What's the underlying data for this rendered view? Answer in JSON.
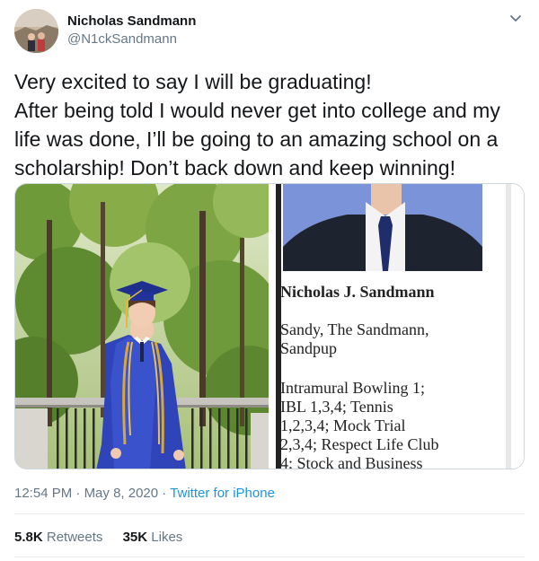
{
  "user": {
    "display_name": "Nicholas Sandmann",
    "handle": "@N1ckSandmann"
  },
  "tweet": {
    "text": "Very excited to say I will be graduating!\nAfter being told I would never get into college and my life was done, I’ll be going to an amazing school on a scholarship! Don’t back down and keep winning!"
  },
  "media": {
    "yearbook": {
      "name": "Nicholas J. Sandmann",
      "nicknames": "Sandy, The Sandmann,\nSandpup",
      "activities": "Intramural Bowling 1;\nIBL 1,3,4; Tennis\n1,2,3,4; Mock Trial\n2,3,4; Respect Life Club\n4; Stock and Business"
    }
  },
  "meta": {
    "time": "12:54 PM",
    "separator": " · ",
    "date": "May 8, 2020",
    "source": "Twitter for iPhone"
  },
  "stats": {
    "retweets_count": "5.8K",
    "retweets_label": "Retweets",
    "likes_count": "35K",
    "likes_label": "Likes"
  },
  "icons": {
    "caret": "chevron-down-icon"
  },
  "colors": {
    "link": "#1b95e0",
    "secondary_text": "#657786",
    "divider": "#e6ecf0"
  }
}
